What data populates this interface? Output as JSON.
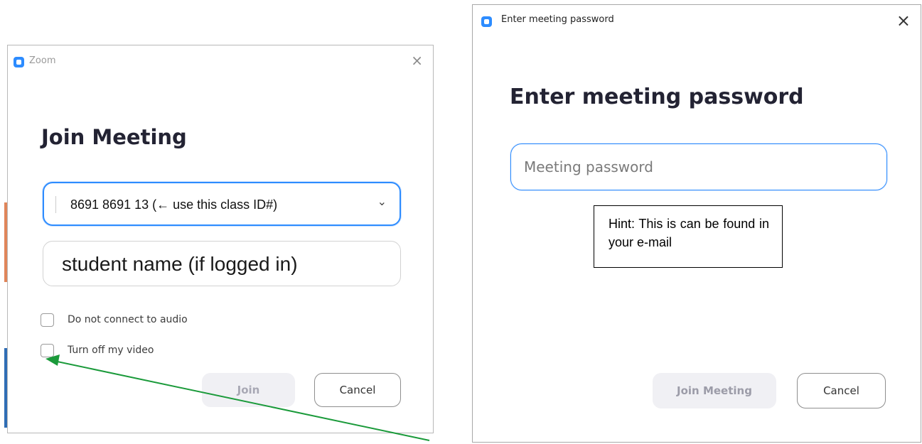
{
  "left_window": {
    "title": "Zoom",
    "close_glyph": "×",
    "heading": "Join Meeting",
    "meeting_id_value": "8691 8691 13 (← use this class ID#)",
    "dropdown_glyph": "⌄",
    "name_value": "student name (if logged in)",
    "option_audio_label": "Do not connect to audio",
    "option_audio_checked": false,
    "option_video_label": "Turn off my video",
    "option_video_checked": false,
    "join_label": "Join",
    "cancel_label": "Cancel"
  },
  "right_window": {
    "title": "Enter meeting password",
    "close_glyph": "×",
    "heading": "Enter meeting password",
    "password_placeholder": "Meeting password",
    "hint_text": "Hint: This is can be found in your e-mail",
    "join_label": "Join Meeting",
    "cancel_label": "Cancel"
  },
  "colors": {
    "accent": "#2d8cff",
    "annotation_arrow": "#1a9a3a",
    "disabled_button_bg": "#f0f0f4"
  },
  "icons": {
    "app_icon": "zoom-camera-icon",
    "close": "close-icon",
    "dropdown": "chevron-down-icon",
    "annotation": "arrow-icon"
  }
}
